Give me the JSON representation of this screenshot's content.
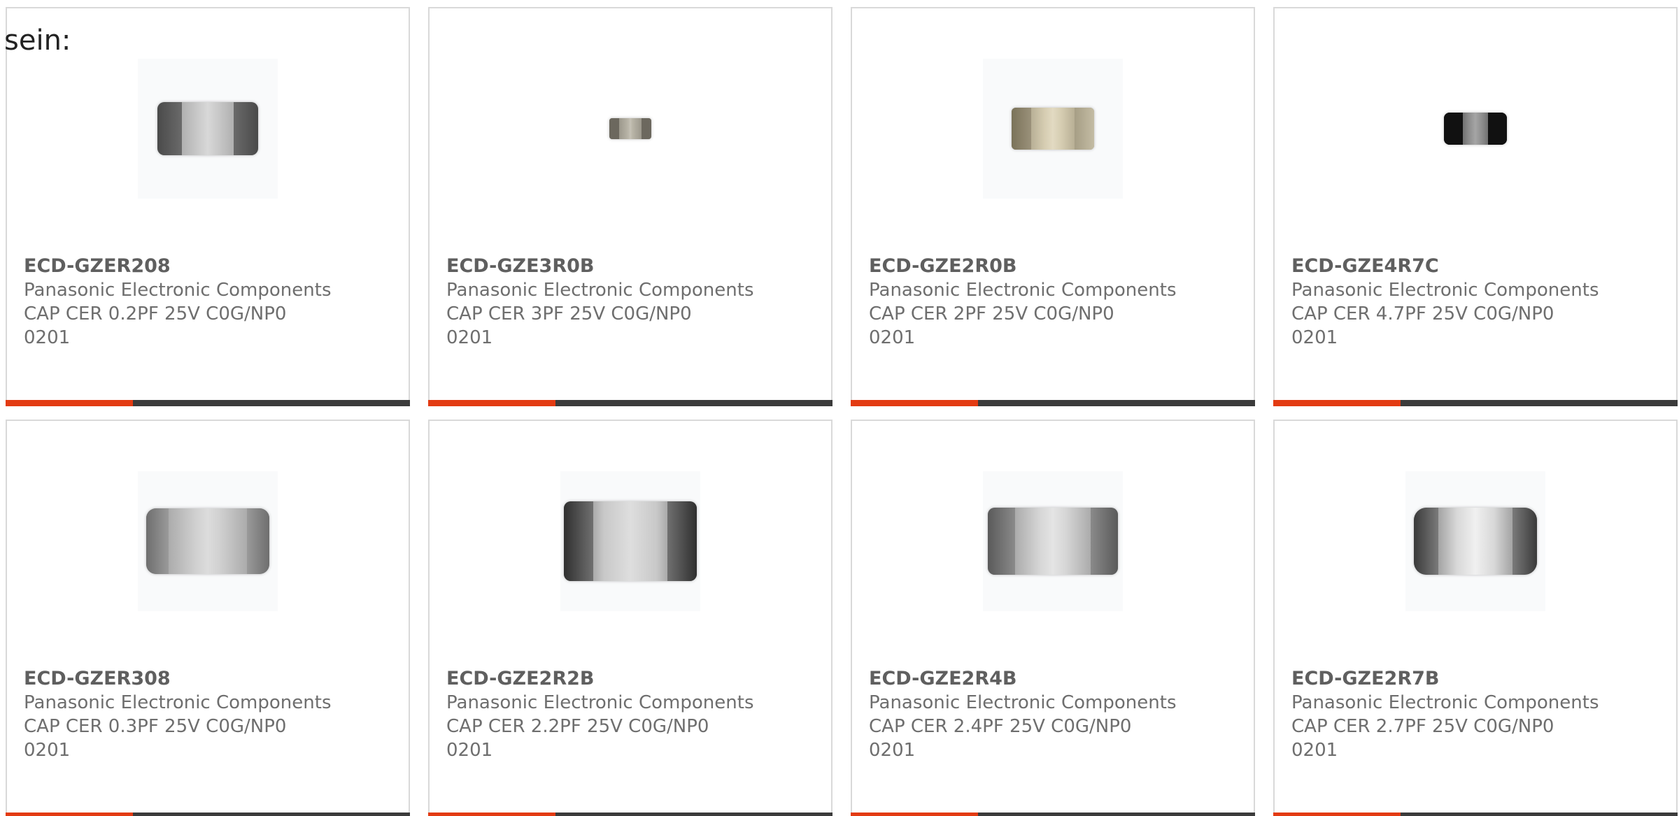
{
  "intro_text": "sein:",
  "colors": {
    "accent": "#e33b12",
    "bar": "#3b3b3b",
    "card_border": "#d9d9d9",
    "text_bold": "#5f5f5f",
    "text": "#6e6e6e"
  },
  "products": [
    {
      "part_number": "ECD-GZER208",
      "manufacturer": "Panasonic Electronic Components",
      "description": "CAP CER 0.2PF 25V C0G/NP0 0201",
      "image_icon": "ceramic-capacitor-chip-icon"
    },
    {
      "part_number": "ECD-GZE3R0B",
      "manufacturer": "Panasonic Electronic Components",
      "description": "CAP CER 3PF 25V C0G/NP0 0201",
      "image_icon": "ceramic-capacitor-chip-icon"
    },
    {
      "part_number": "ECD-GZE2R0B",
      "manufacturer": "Panasonic Electronic Components",
      "description": "CAP CER 2PF 25V C0G/NP0 0201",
      "image_icon": "ceramic-capacitor-chip-icon"
    },
    {
      "part_number": "ECD-GZE4R7C",
      "manufacturer": "Panasonic Electronic Components",
      "description": "CAP CER 4.7PF 25V C0G/NP0 0201",
      "image_icon": "ceramic-capacitor-chip-icon"
    },
    {
      "part_number": "ECD-GZER308",
      "manufacturer": "Panasonic Electronic Components",
      "description": "CAP CER 0.3PF 25V C0G/NP0 0201",
      "image_icon": "ceramic-capacitor-chip-icon"
    },
    {
      "part_number": "ECD-GZE2R2B",
      "manufacturer": "Panasonic Electronic Components",
      "description": "CAP CER 2.2PF 25V C0G/NP0 0201",
      "image_icon": "ceramic-capacitor-chip-icon"
    },
    {
      "part_number": "ECD-GZE2R4B",
      "manufacturer": "Panasonic Electronic Components",
      "description": "CAP CER 2.4PF 25V C0G/NP0 0201",
      "image_icon": "ceramic-capacitor-chip-icon"
    },
    {
      "part_number": "ECD-GZE2R7B",
      "manufacturer": "Panasonic Electronic Components",
      "description": "CAP CER 2.7PF 25V C0G/NP0 0201",
      "image_icon": "ceramic-capacitor-chip-icon"
    }
  ]
}
